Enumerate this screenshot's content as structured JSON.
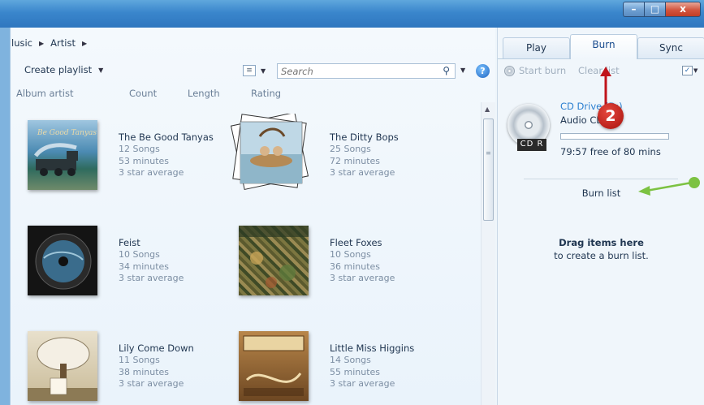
{
  "window": {
    "minimize_glyph": "–",
    "maximize_glyph": "□",
    "close_glyph": "x"
  },
  "breadcrumb": [
    "lusic",
    "Artist"
  ],
  "toolbar": {
    "create_playlist": "Create playlist",
    "search_placeholder": "Search"
  },
  "columns": [
    "Album artist",
    "Count",
    "Length",
    "Rating"
  ],
  "albums": [
    {
      "title": "The Be Good Tanyas",
      "songs": "12 Songs",
      "length": "53 minutes",
      "rating": "3 star average"
    },
    {
      "title": "The Ditty Bops",
      "songs": "25 Songs",
      "length": "72 minutes",
      "rating": "3 star average"
    },
    {
      "title": "Feist",
      "songs": "10 Songs",
      "length": "34 minutes",
      "rating": "3 star average"
    },
    {
      "title": "Fleet Foxes",
      "songs": "10 Songs",
      "length": "36 minutes",
      "rating": "3 star average"
    },
    {
      "title": "Lily Come Down",
      "songs": "11 Songs",
      "length": "38 minutes",
      "rating": "3 star average"
    },
    {
      "title": "Little Miss Higgins",
      "songs": "14 Songs",
      "length": "55 minutes",
      "rating": "3 star average"
    }
  ],
  "tabs": [
    "Play",
    "Burn",
    "Sync"
  ],
  "burn": {
    "start_burn": "Start burn",
    "clear_list": "Clear list",
    "drive_name": "CD Drive (D:)",
    "disc_type": "Audio CD",
    "disc_tag": "CD R",
    "free_space": "79:57 free of 80 mins",
    "free_fraction": 0.0,
    "list_title": "Burn list",
    "drag_title": "Drag items here",
    "drag_subtitle": "to create a burn list."
  },
  "annotation": {
    "step_number": "2",
    "arrow_color": "#c0141b",
    "pointer_color": "#7cc242"
  }
}
